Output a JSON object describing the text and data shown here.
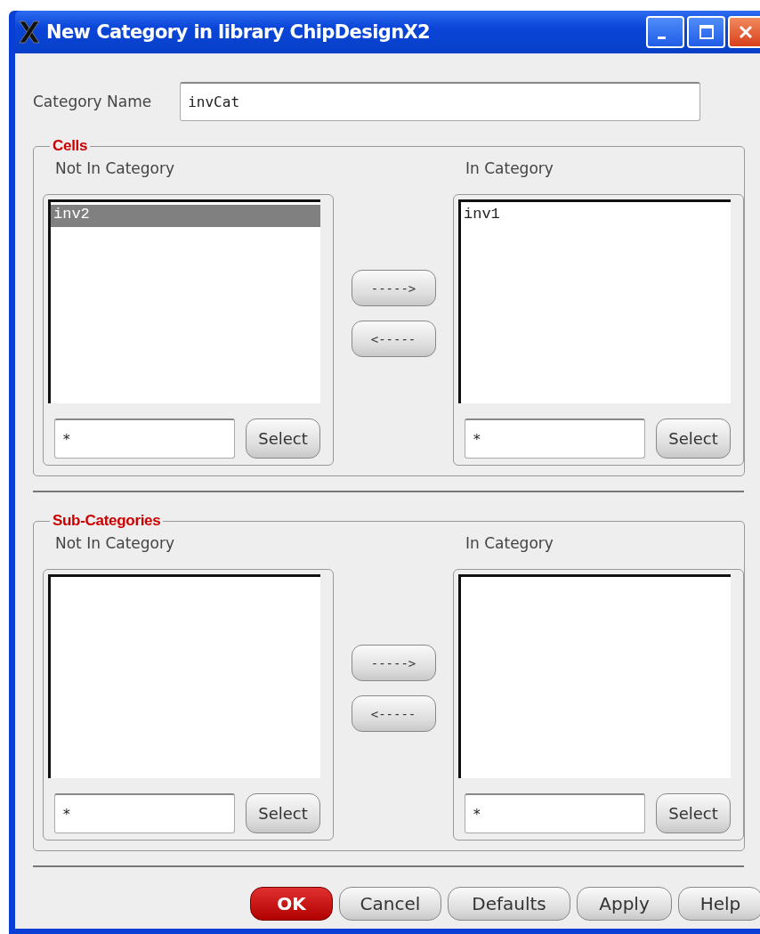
{
  "window": {
    "title": "New Category in library ChipDesignX2"
  },
  "category_name": {
    "label": "Category Name",
    "value": "invCat"
  },
  "groups": [
    {
      "title": "Cells",
      "move_right": "----->",
      "move_left": "<-----",
      "panes": [
        {
          "label": "Not In Category",
          "items": [
            {
              "text": "inv2",
              "selected": true
            }
          ],
          "filter": "*",
          "select_button": "Select"
        },
        {
          "label": "In Category",
          "items": [
            {
              "text": "inv1",
              "selected": false
            }
          ],
          "filter": "*",
          "select_button": "Select"
        }
      ]
    },
    {
      "title": "Sub-Categories",
      "move_right": "----->",
      "move_left": "<-----",
      "panes": [
        {
          "label": "Not In Category",
          "filter": "*",
          "select_button": "Select"
        },
        {
          "label": "In Category",
          "filter": "*",
          "select_button": "Select"
        }
      ]
    }
  ],
  "buttons": [
    {
      "label": "OK",
      "kind": "default"
    },
    {
      "label": "Cancel",
      "kind": "normal"
    },
    {
      "label": "Defaults",
      "kind": "normal"
    },
    {
      "label": "Apply",
      "kind": "normal"
    },
    {
      "label": "Help",
      "kind": "normal"
    }
  ]
}
